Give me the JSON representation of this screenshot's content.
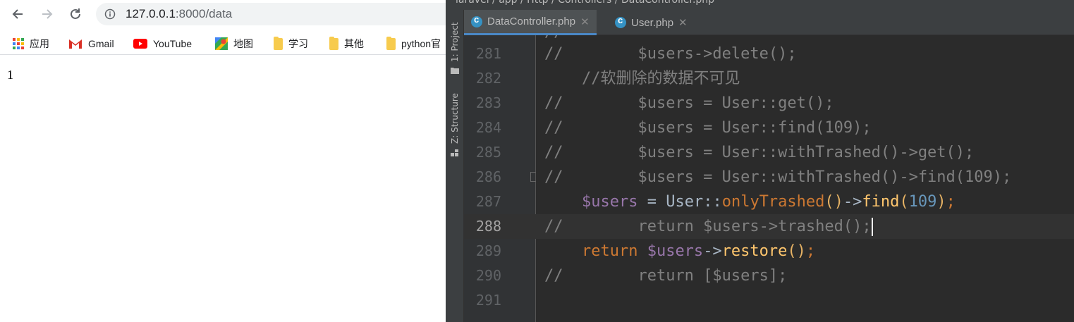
{
  "browser": {
    "url_host": "127.0.0.1",
    "url_rest": ":8000/data",
    "bookmarks": [
      {
        "label": "应用",
        "icon": "apps-grid-icon"
      },
      {
        "label": "Gmail",
        "icon": "gmail-icon"
      },
      {
        "label": "YouTube",
        "icon": "youtube-icon"
      },
      {
        "label": "地图",
        "icon": "maps-icon"
      },
      {
        "label": "学习",
        "icon": "folder-icon"
      },
      {
        "label": "其他",
        "icon": "folder-icon"
      },
      {
        "label": "python官",
        "icon": "folder-icon"
      }
    ],
    "page_text": "1"
  },
  "ide": {
    "breadcrumb": "laravel / app / Http / Controllers / DataController.php",
    "side_labels": {
      "project": "1: Project",
      "structure": "Z: Structure"
    },
    "tabs": [
      {
        "label": "DataController.php",
        "active": true
      },
      {
        "label": "User.php",
        "active": false
      }
    ],
    "current_line": 288,
    "lines": [
      {
        "num": "281",
        "comment": "//",
        "code": "        $users->delete();"
      },
      {
        "num": "282",
        "comment": "",
        "code": "    //软删除的数据不可见"
      },
      {
        "num": "283",
        "comment": "//",
        "code": "        $users = User::get();"
      },
      {
        "num": "284",
        "comment": "//",
        "code": "        $users = User::find(109);"
      },
      {
        "num": "285",
        "comment": "//",
        "code": "        $users = User::withTrashed()->get();"
      },
      {
        "num": "286",
        "comment": "//",
        "code": "        $users = User::withTrashed()->find(109);"
      },
      {
        "num": "287"
      },
      {
        "num": "288",
        "comment": "//",
        "code": "        return $users->trashed();"
      },
      {
        "num": "289"
      },
      {
        "num": "290",
        "comment": "//",
        "code": "        return [$users];"
      },
      {
        "num": "291"
      }
    ],
    "line287": {
      "var": "$users",
      "eq": " = ",
      "cls": "User",
      "sep": "::",
      "m1": "onlyTrashed",
      "p1": "()",
      "arrow": "->",
      "m2": "find",
      "po": "(",
      "n": "109",
      "pc": ")",
      "semi": ";"
    },
    "line289": {
      "kw": "return ",
      "var": "$users",
      "arrow": "->",
      "m": "restore",
      "p": "()",
      "semi": ";"
    }
  }
}
